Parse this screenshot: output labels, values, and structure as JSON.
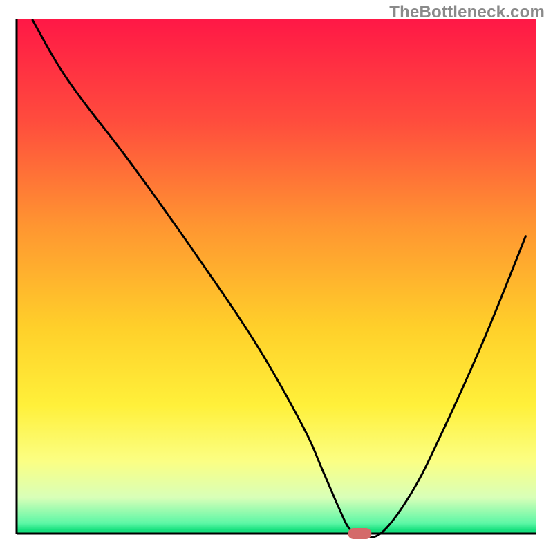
{
  "watermark": "TheBottleneck.com",
  "chart_data": {
    "type": "line",
    "title": "",
    "xlabel": "",
    "ylabel": "",
    "xlim": [
      0,
      100
    ],
    "ylim": [
      0,
      100
    ],
    "background": {
      "type": "vertical-gradient",
      "stops": [
        {
          "offset": 0.0,
          "color": "#ff1846"
        },
        {
          "offset": 0.2,
          "color": "#ff4d3d"
        },
        {
          "offset": 0.4,
          "color": "#ff9531"
        },
        {
          "offset": 0.6,
          "color": "#ffd02a"
        },
        {
          "offset": 0.75,
          "color": "#fff03a"
        },
        {
          "offset": 0.86,
          "color": "#fbff84"
        },
        {
          "offset": 0.93,
          "color": "#d8ffb8"
        },
        {
          "offset": 0.98,
          "color": "#5cf7a6"
        },
        {
          "offset": 0.993,
          "color": "#18e07f"
        },
        {
          "offset": 1.0,
          "color": "#18e07f"
        }
      ]
    },
    "series": [
      {
        "name": "bottleneck-curve",
        "color": "#000000",
        "width": 3,
        "x": [
          3,
          10,
          22,
          34,
          46,
          55,
          59,
          62,
          64,
          66,
          70,
          76,
          82,
          90,
          98
        ],
        "y": [
          100,
          88,
          72,
          55,
          37,
          21,
          12,
          5,
          1,
          0,
          0,
          8,
          20,
          38,
          58
        ]
      }
    ],
    "marker": {
      "name": "optimal-point",
      "shape": "rounded-pill",
      "x": 66,
      "y": 0,
      "fill": "#d46a6a"
    },
    "axes": {
      "left": {
        "x": 3,
        "color": "#000000",
        "width": 3
      },
      "bottom": {
        "y": 0,
        "color": "#000000",
        "width": 3
      }
    }
  }
}
